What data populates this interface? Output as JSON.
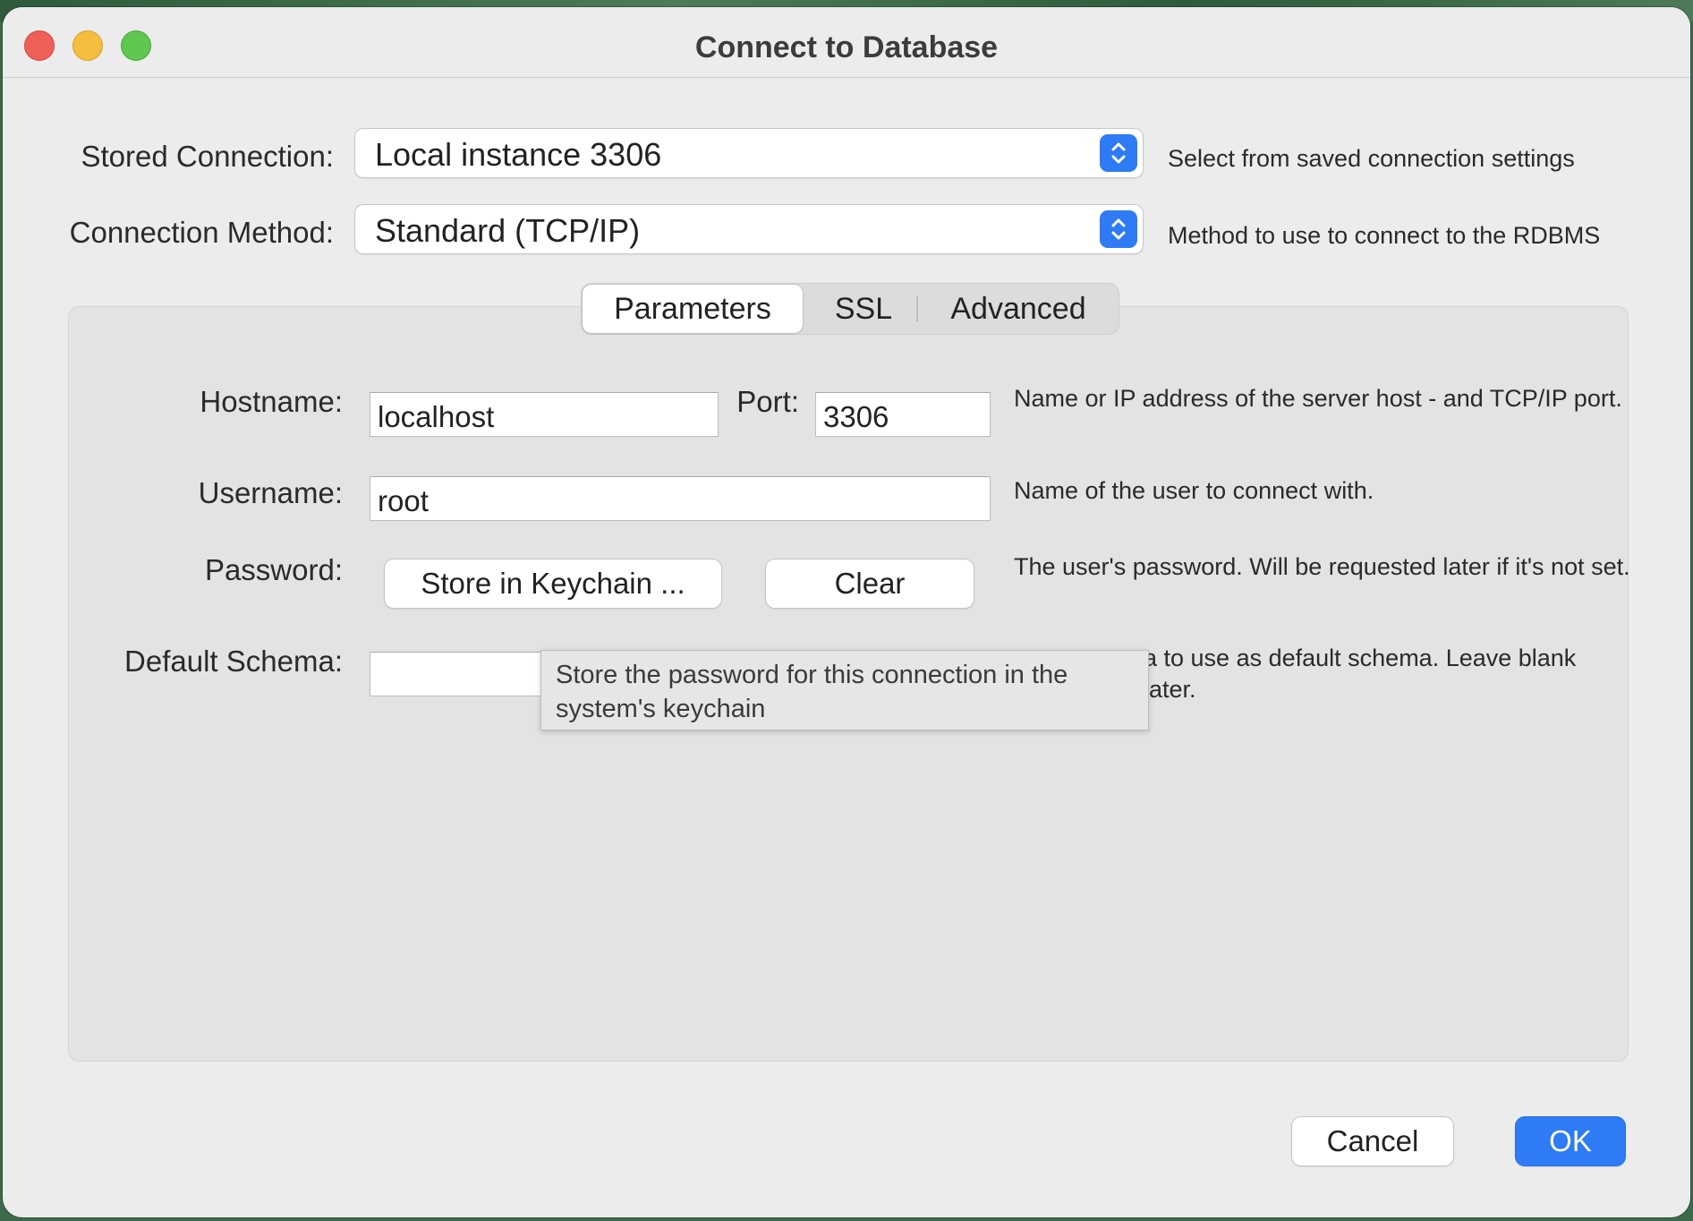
{
  "window": {
    "title": "Connect to Database"
  },
  "stored_connection": {
    "label": "Stored Connection:",
    "value": "Local instance 3306",
    "help": "Select from saved connection settings"
  },
  "connection_method": {
    "label": "Connection Method:",
    "value": "Standard (TCP/IP)",
    "help": "Method to use to connect to the RDBMS"
  },
  "tabs": [
    {
      "label": "Parameters",
      "active": true
    },
    {
      "label": "SSL",
      "active": false
    },
    {
      "label": "Advanced",
      "active": false
    }
  ],
  "parameters": {
    "hostname": {
      "label": "Hostname:",
      "value": "localhost"
    },
    "port": {
      "label": "Port:",
      "value": "3306"
    },
    "hostname_help": "Name or IP address of the server host - and TCP/IP port.",
    "username": {
      "label": "Username:",
      "value": "root",
      "help": "Name of the user to connect with."
    },
    "password": {
      "label": "Password:",
      "store_button": "Store in Keychain ...",
      "clear_button": "Clear",
      "help": "The user's password. Will be requested later if it's not set."
    },
    "default_schema": {
      "label": "Default Schema:",
      "value": "",
      "help_visible": "a to use as default schema. Leave blank later."
    }
  },
  "tooltip": {
    "text": "Store the password for this connection in the system's keychain"
  },
  "footer": {
    "cancel": "Cancel",
    "ok": "OK"
  },
  "colors": {
    "accent": "#2f7bf5",
    "close": "#ed5f57",
    "minimize": "#f5bd3f",
    "zoom": "#5fc650"
  }
}
